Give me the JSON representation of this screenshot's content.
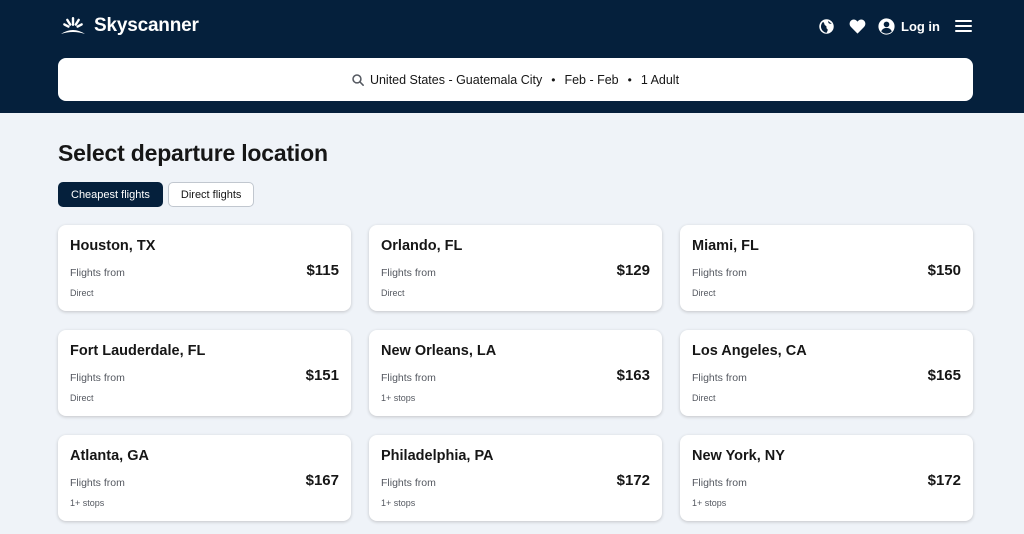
{
  "brand": {
    "name": "Skyscanner"
  },
  "header": {
    "login_label": "Log in",
    "icons": [
      "globe-icon",
      "heart-icon",
      "account-icon",
      "menu-icon"
    ]
  },
  "search": {
    "route": "United States - Guatemala City",
    "dates": "Feb - Feb",
    "travellers": "1 Adult",
    "separator": "•"
  },
  "page": {
    "title": "Select departure location"
  },
  "filters": [
    {
      "label": "Cheapest flights",
      "active": true
    },
    {
      "label": "Direct flights",
      "active": false
    }
  ],
  "destinations": [
    {
      "city": "Houston, TX",
      "from_label": "Flights from",
      "price": "$115",
      "stops": "Direct"
    },
    {
      "city": "Orlando, FL",
      "from_label": "Flights from",
      "price": "$129",
      "stops": "Direct"
    },
    {
      "city": "Miami, FL",
      "from_label": "Flights from",
      "price": "$150",
      "stops": "Direct"
    },
    {
      "city": "Fort Lauderdale, FL",
      "from_label": "Flights from",
      "price": "$151",
      "stops": "Direct"
    },
    {
      "city": "New Orleans, LA",
      "from_label": "Flights from",
      "price": "$163",
      "stops": "1+ stops"
    },
    {
      "city": "Los Angeles, CA",
      "from_label": "Flights from",
      "price": "$165",
      "stops": "Direct"
    },
    {
      "city": "Atlanta, GA",
      "from_label": "Flights from",
      "price": "$167",
      "stops": "1+ stops"
    },
    {
      "city": "Philadelphia, PA",
      "from_label": "Flights from",
      "price": "$172",
      "stops": "1+ stops"
    },
    {
      "city": "New York, NY",
      "from_label": "Flights from",
      "price": "$172",
      "stops": "1+ stops"
    }
  ],
  "colors": {
    "header_bg": "#05203c",
    "page_bg": "#eff3f8",
    "card_bg": "#ffffff",
    "chip_active_bg": "#05203c",
    "text_primary": "#161616",
    "text_secondary": "#545860"
  }
}
